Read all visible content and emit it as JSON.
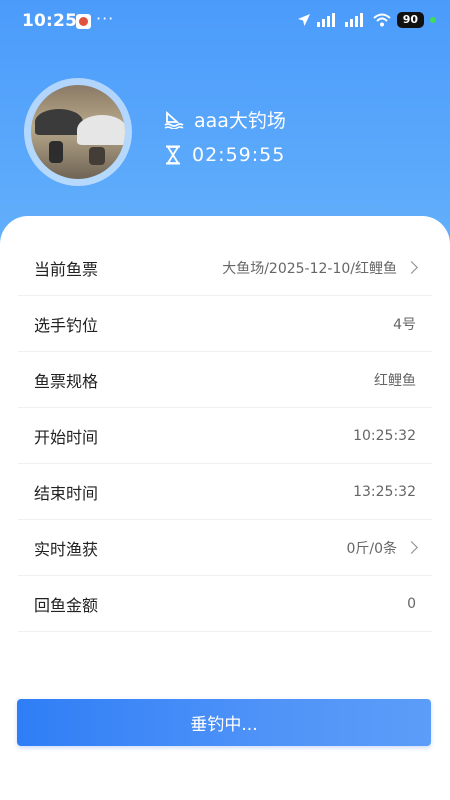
{
  "status_bar": {
    "time": "10:25",
    "more": "···",
    "battery": "90"
  },
  "profile": {
    "venue_name": "aaa大钓场",
    "timer": "02:59:55"
  },
  "details": [
    {
      "label": "当前鱼票",
      "value": "大鱼场/2025-12-10/红鲤鱼"
    },
    {
      "label": "选手钓位",
      "value": "4号"
    },
    {
      "label": "鱼票规格",
      "value": "红鲤鱼"
    },
    {
      "label": "开始时间",
      "value": "10:25:32"
    },
    {
      "label": "结束时间",
      "value": "13:25:32"
    },
    {
      "label": "实时渔获",
      "value": "0斤/0条"
    },
    {
      "label": "回鱼金额",
      "value": "0"
    }
  ],
  "action_button": {
    "label": "垂钓中..."
  },
  "colors": {
    "header_blue": "#4b9bfb",
    "button_blue": "#2f7ef6",
    "charge_green": "#3ddc5a"
  }
}
